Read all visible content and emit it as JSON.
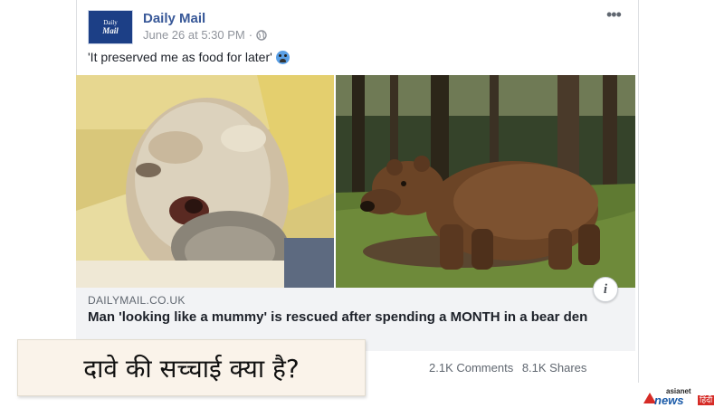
{
  "post": {
    "avatar_line1": "Daily",
    "avatar_line2": "Mail",
    "page_name": "Daily Mail",
    "timestamp": "June 26 at 5:30 PM",
    "separator": "·",
    "more_label": "•••",
    "caption": "'It preserved me as food for later'"
  },
  "link": {
    "info_label": "i",
    "domain": "DAILYMAIL.CO.UK",
    "headline": "Man 'looking like a mummy' is rescued after spending a MONTH in a bear den"
  },
  "overlay": {
    "text": "दावे की सच्चाई क्या है?"
  },
  "stats": {
    "comments": "2.1K Comments",
    "shares": "8.1K Shares"
  },
  "logo": {
    "line1": "asianet",
    "line2": "news",
    "badge": "हिंदी"
  },
  "colors": {
    "link_blue": "#385898",
    "meta_gray": "#90949c",
    "link_box_bg": "#f2f3f5",
    "overlay_bg": "#faf3ea"
  }
}
